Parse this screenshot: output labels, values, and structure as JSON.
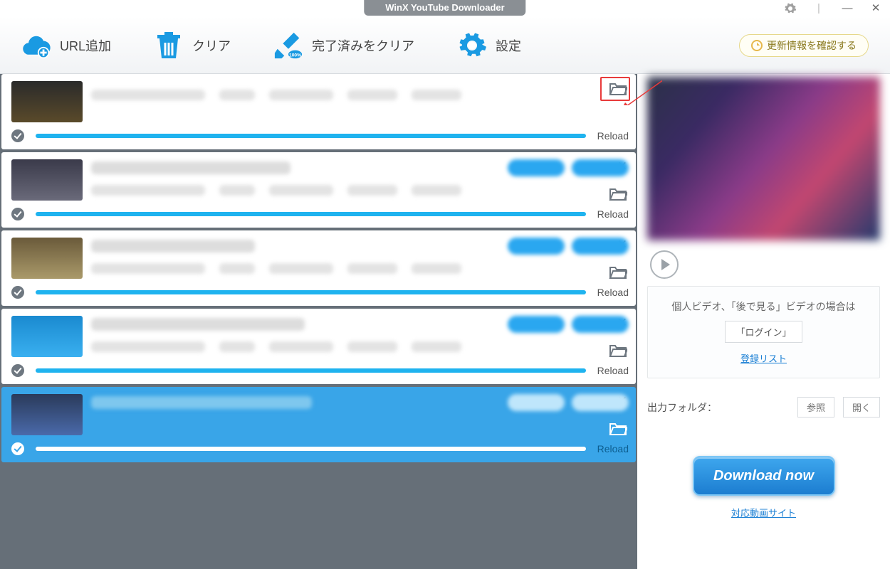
{
  "app_title": "WinX YouTube Downloader",
  "window": {
    "minimize": "—",
    "close": "✕",
    "gear": "settings"
  },
  "toolbar": {
    "addurl": "URL追加",
    "clear": "クリア",
    "clear_done": "完了済みをクリア",
    "settings": "設定",
    "update": "更新情報を確認する"
  },
  "items": [
    {
      "reload": "Reload"
    },
    {
      "reload": "Reload"
    },
    {
      "reload": "Reload"
    },
    {
      "reload": "Reload"
    },
    {
      "reload": "Reload"
    }
  ],
  "side": {
    "login_msg": "個人ビデオ、「後で見る」ビデオの場合は",
    "login_btn": "「ログイン」",
    "register_link": "登録リスト",
    "out_label": "出力フォルダ：",
    "browse": "参照",
    "open": "開く",
    "download_now": "Download now",
    "sites_link": "対応動画サイト"
  }
}
